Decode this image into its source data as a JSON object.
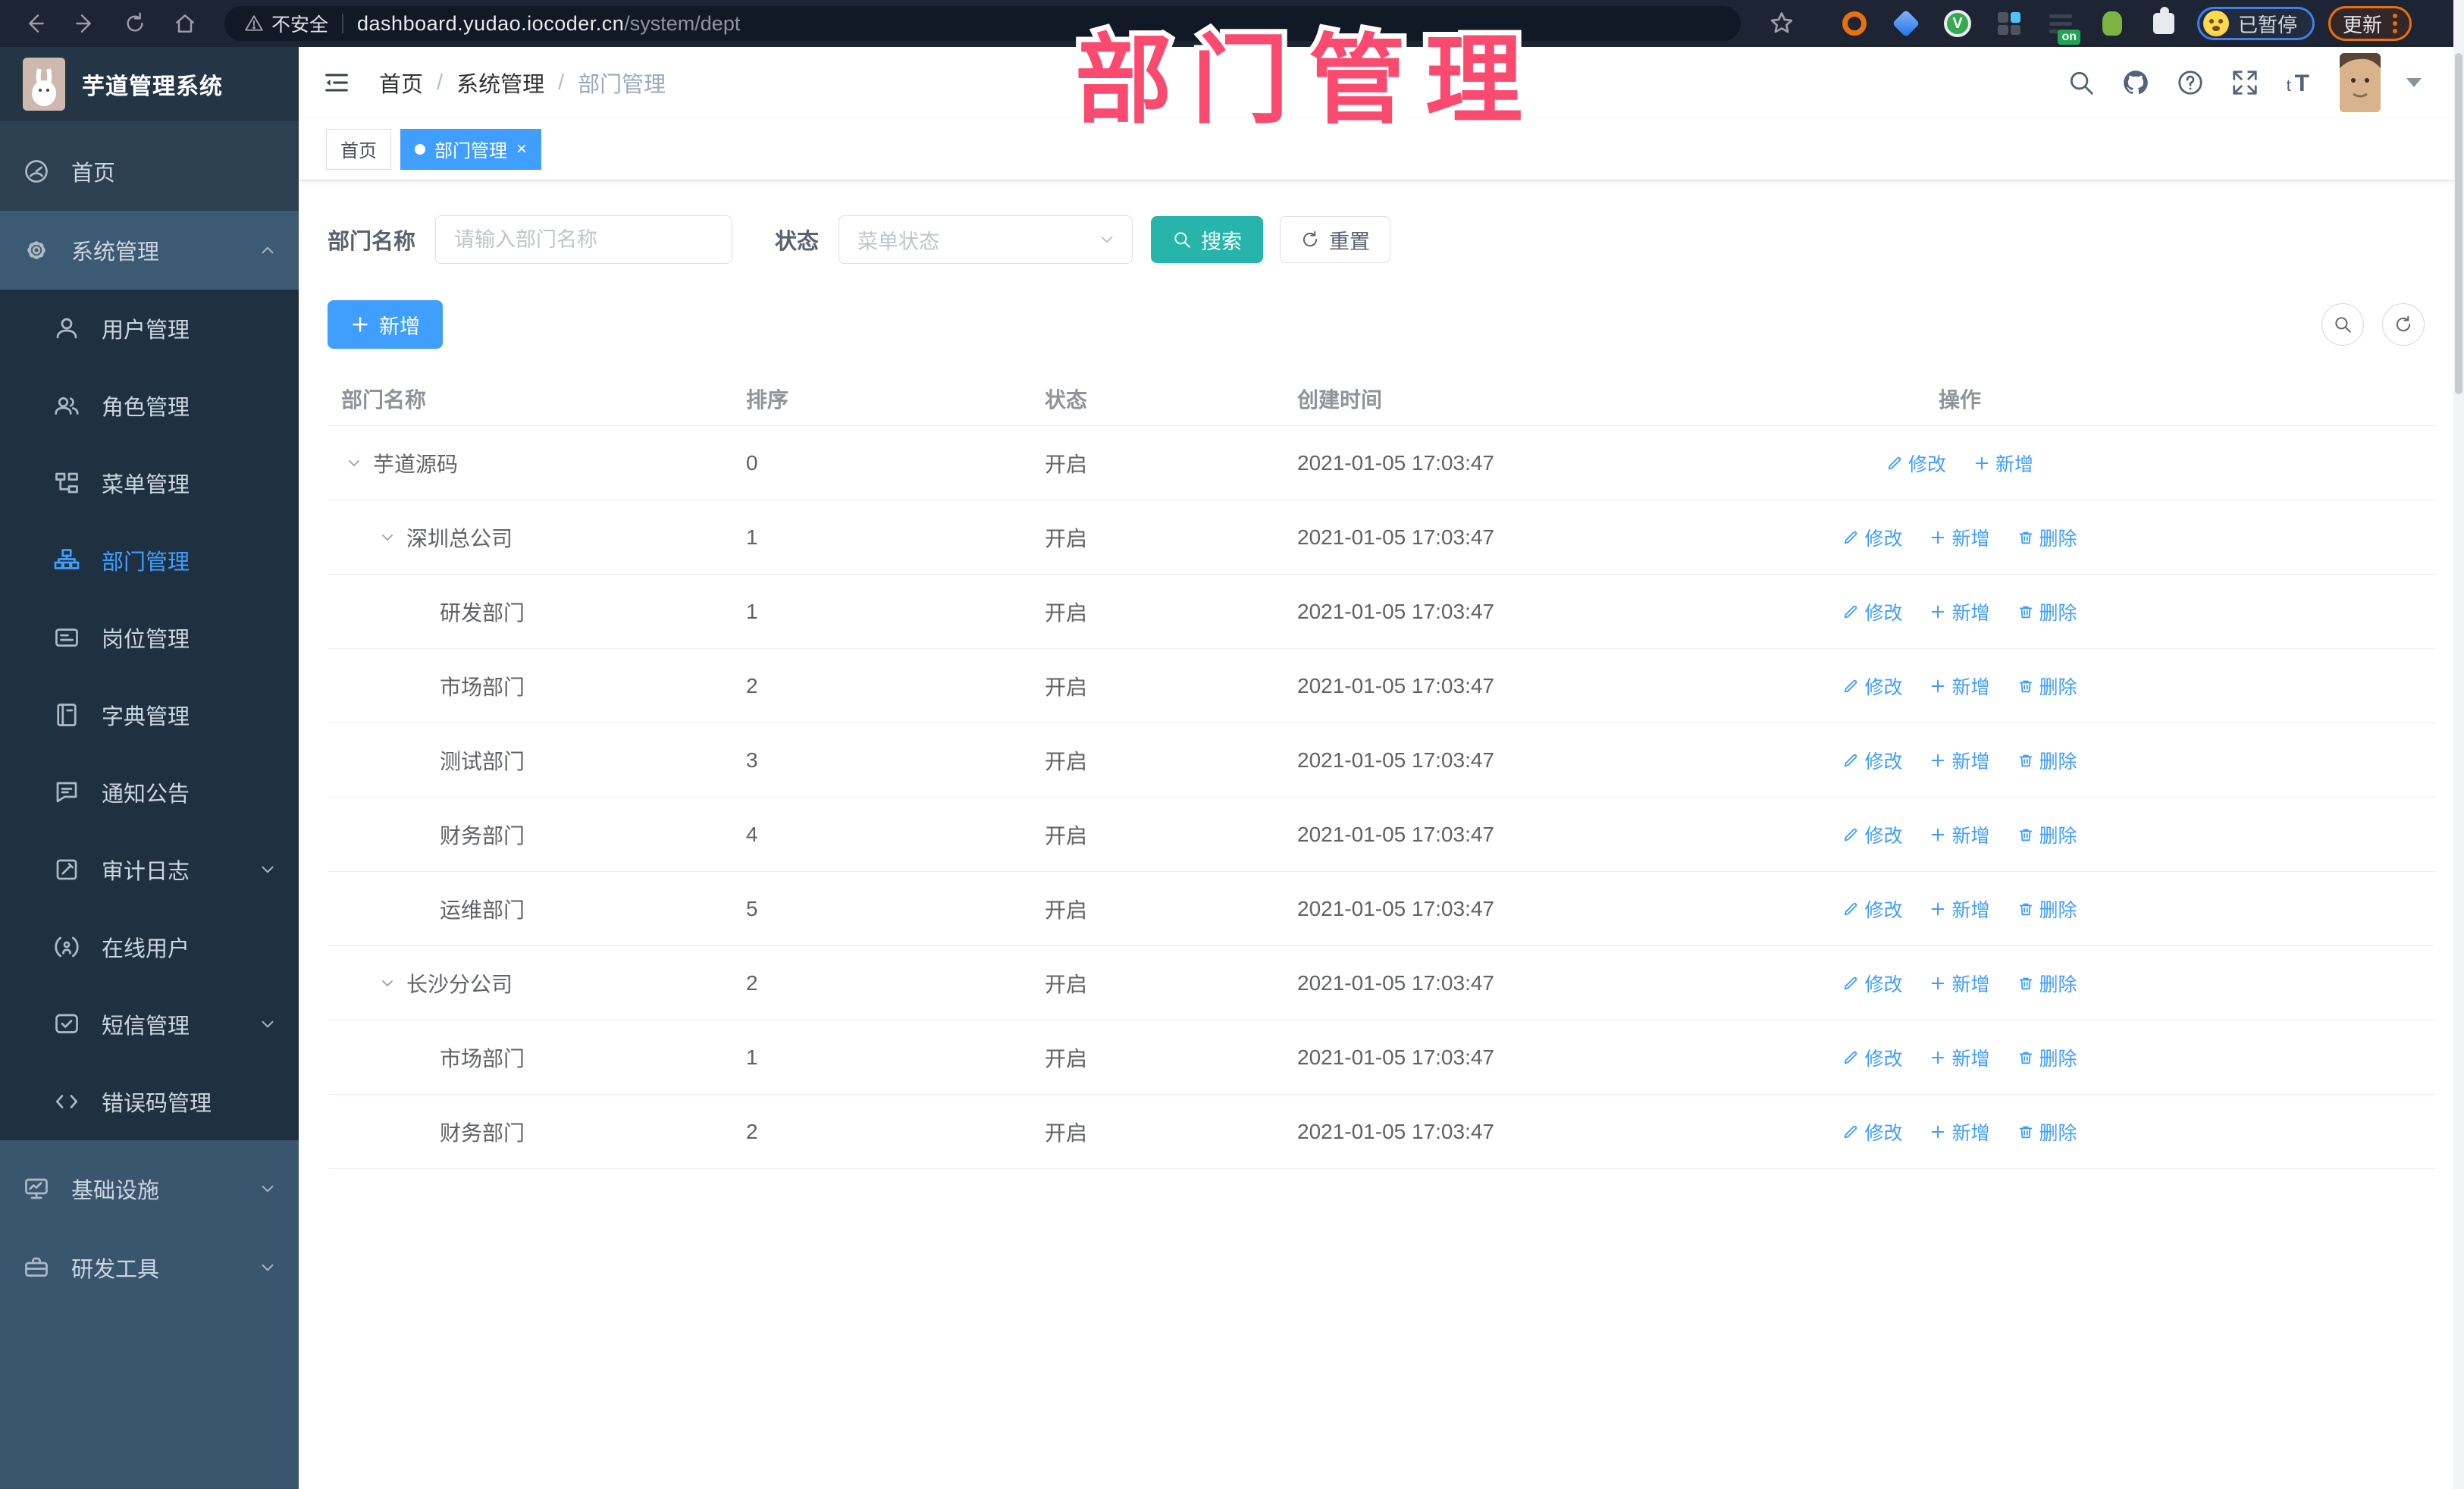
{
  "browser": {
    "unsafe_label": "不安全",
    "url_host": "dashboard.yudao.iocoder.cn",
    "url_path": "/system/dept",
    "ext_badge": "on",
    "profile_status": "已暂停",
    "update_label": "更新"
  },
  "annotation": {
    "title": "部门管理",
    "color": "#fa4a6f"
  },
  "colors": {
    "accent": "#409eff",
    "search_teal": "#27b5ab",
    "sidebar_dark": "#1f3140",
    "active_tab": "#409eff"
  },
  "sidebar": {
    "app_title": "芋道管理系统",
    "items": [
      {
        "id": "home",
        "zone": "top",
        "icon": "dashboard",
        "label": "首页"
      },
      {
        "id": "system",
        "zone": "open",
        "icon": "gear",
        "label": "系统管理",
        "chevron": "up"
      },
      {
        "id": "user",
        "zone": "sub",
        "icon": "user",
        "label": "用户管理"
      },
      {
        "id": "role",
        "zone": "sub",
        "icon": "peoples",
        "label": "角色管理"
      },
      {
        "id": "menu",
        "zone": "sub",
        "icon": "treetable",
        "label": "菜单管理"
      },
      {
        "id": "dept",
        "zone": "sub",
        "icon": "tree",
        "label": "部门管理",
        "active": true
      },
      {
        "id": "post",
        "zone": "sub",
        "icon": "post",
        "label": "岗位管理"
      },
      {
        "id": "dict",
        "zone": "sub",
        "icon": "dict",
        "label": "字典管理"
      },
      {
        "id": "notice",
        "zone": "sub",
        "icon": "message",
        "label": "通知公告"
      },
      {
        "id": "audit",
        "zone": "sub",
        "icon": "log",
        "label": "审计日志",
        "chevron": "down"
      },
      {
        "id": "online",
        "zone": "sub",
        "icon": "online",
        "label": "在线用户"
      },
      {
        "id": "sms",
        "zone": "sub",
        "icon": "sms",
        "label": "短信管理",
        "chevron": "down"
      },
      {
        "id": "errcode",
        "zone": "sub",
        "icon": "code",
        "label": "错误码管理"
      },
      {
        "id": "infra",
        "zone": "bottom",
        "icon": "monitor",
        "label": "基础设施",
        "chevron": "down"
      },
      {
        "id": "devtool",
        "zone": "bottom",
        "icon": "tool",
        "label": "研发工具",
        "chevron": "down"
      }
    ]
  },
  "header": {
    "breadcrumbs": [
      "首页",
      "系统管理",
      "部门管理"
    ]
  },
  "tabs": [
    {
      "id": "home",
      "label": "首页",
      "active": false,
      "closable": false
    },
    {
      "id": "dept",
      "label": "部门管理",
      "active": true,
      "closable": true
    }
  ],
  "filters": {
    "dept_label": "部门名称",
    "dept_placeholder": "请输入部门名称",
    "dept_value": "",
    "status_label": "状态",
    "status_placeholder": "菜单状态",
    "search_label": "搜索",
    "reset_label": "重置"
  },
  "toolbar": {
    "add_label": "新增"
  },
  "table": {
    "columns": [
      "部门名称",
      "排序",
      "状态",
      "创建时间",
      "操作"
    ],
    "rows": [
      {
        "name": "芋道源码",
        "level": 0,
        "expandable": true,
        "sort": "0",
        "status": "开启",
        "created": "2021-01-05 17:03:47",
        "actions": [
          {
            "label": "修改",
            "icon": "edit"
          },
          {
            "label": "新增",
            "icon": "plus"
          }
        ]
      },
      {
        "name": "深圳总公司",
        "level": 1,
        "expandable": true,
        "sort": "1",
        "status": "开启",
        "created": "2021-01-05 17:03:47",
        "actions": [
          {
            "label": "修改",
            "icon": "edit"
          },
          {
            "label": "新增",
            "icon": "plus"
          },
          {
            "label": "删除",
            "icon": "delete"
          }
        ]
      },
      {
        "name": "研发部门",
        "level": 2,
        "expandable": false,
        "sort": "1",
        "status": "开启",
        "created": "2021-01-05 17:03:47",
        "actions": [
          {
            "label": "修改",
            "icon": "edit"
          },
          {
            "label": "新增",
            "icon": "plus"
          },
          {
            "label": "删除",
            "icon": "delete"
          }
        ]
      },
      {
        "name": "市场部门",
        "level": 2,
        "expandable": false,
        "sort": "2",
        "status": "开启",
        "created": "2021-01-05 17:03:47",
        "actions": [
          {
            "label": "修改",
            "icon": "edit"
          },
          {
            "label": "新增",
            "icon": "plus"
          },
          {
            "label": "删除",
            "icon": "delete"
          }
        ]
      },
      {
        "name": "测试部门",
        "level": 2,
        "expandable": false,
        "sort": "3",
        "status": "开启",
        "created": "2021-01-05 17:03:47",
        "actions": [
          {
            "label": "修改",
            "icon": "edit"
          },
          {
            "label": "新增",
            "icon": "plus"
          },
          {
            "label": "删除",
            "icon": "delete"
          }
        ]
      },
      {
        "name": "财务部门",
        "level": 2,
        "expandable": false,
        "sort": "4",
        "status": "开启",
        "created": "2021-01-05 17:03:47",
        "actions": [
          {
            "label": "修改",
            "icon": "edit"
          },
          {
            "label": "新增",
            "icon": "plus"
          },
          {
            "label": "删除",
            "icon": "delete"
          }
        ]
      },
      {
        "name": "运维部门",
        "level": 2,
        "expandable": false,
        "sort": "5",
        "status": "开启",
        "created": "2021-01-05 17:03:47",
        "actions": [
          {
            "label": "修改",
            "icon": "edit"
          },
          {
            "label": "新增",
            "icon": "plus"
          },
          {
            "label": "删除",
            "icon": "delete"
          }
        ]
      },
      {
        "name": "长沙分公司",
        "level": 1,
        "expandable": true,
        "sort": "2",
        "status": "开启",
        "created": "2021-01-05 17:03:47",
        "actions": [
          {
            "label": "修改",
            "icon": "edit"
          },
          {
            "label": "新增",
            "icon": "plus"
          },
          {
            "label": "删除",
            "icon": "delete"
          }
        ]
      },
      {
        "name": "市场部门",
        "level": 2,
        "expandable": false,
        "sort": "1",
        "status": "开启",
        "created": "2021-01-05 17:03:47",
        "actions": [
          {
            "label": "修改",
            "icon": "edit"
          },
          {
            "label": "新增",
            "icon": "plus"
          },
          {
            "label": "删除",
            "icon": "delete"
          }
        ]
      },
      {
        "name": "财务部门",
        "level": 2,
        "expandable": false,
        "sort": "2",
        "status": "开启",
        "created": "2021-01-05 17:03:47",
        "actions": [
          {
            "label": "修改",
            "icon": "edit"
          },
          {
            "label": "新增",
            "icon": "plus"
          },
          {
            "label": "删除",
            "icon": "delete"
          }
        ]
      }
    ]
  }
}
